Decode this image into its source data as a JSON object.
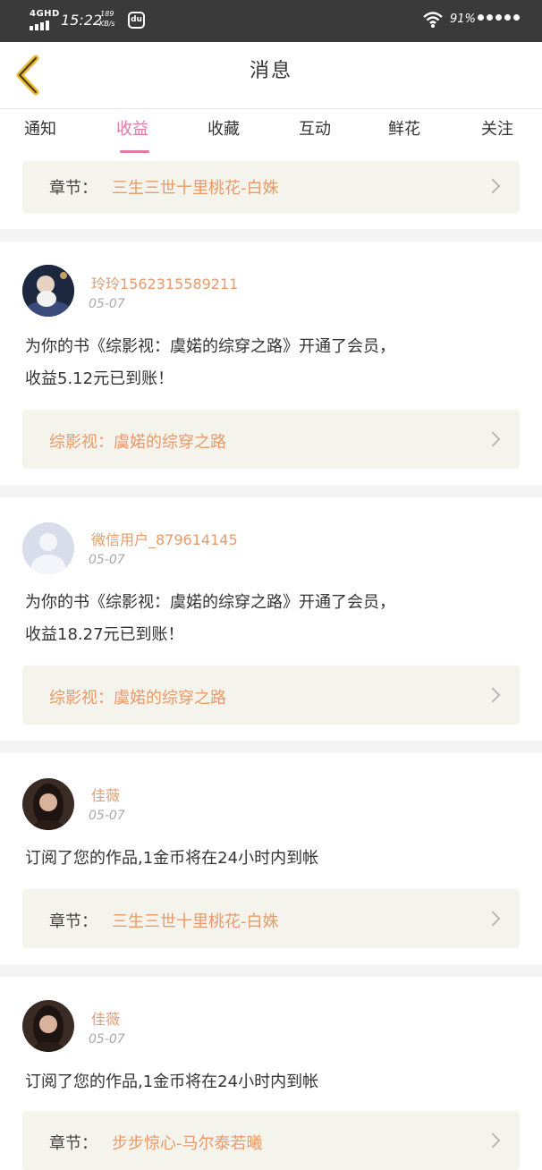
{
  "status": {
    "network": "4GHD",
    "time": "15:22",
    "speed_value": "189",
    "speed_unit": "KB/s",
    "battery": "91%",
    "app_icon_text": "du"
  },
  "header": {
    "title": "消息",
    "back_icon": "chevron-left-icon",
    "accent_color": "#e8b832"
  },
  "tabs": [
    "通知",
    "收益",
    "收藏",
    "互动",
    "鲜花",
    "关注"
  ],
  "active_tab": "收益",
  "colors": {
    "accent": "#e07aa6",
    "orange": "#e89a6a",
    "card_bg": "#f5f4ec"
  },
  "top_card": {
    "label": "章节：",
    "value": "三生三世十里桃花-白姝"
  },
  "messages": [
    {
      "username": "玲玲15623155892​11",
      "date": "05-07",
      "text_line1": "为你的书《综影视：虞婼的综穿之路》开通了会员，",
      "text_line2": "收益5.12元已到账！",
      "book": "综影视：虞婼的综穿之路"
    },
    {
      "username": "微信用户_879614145",
      "date": "05-07",
      "text_line1": "为你的书《综影视：虞婼的综穿之路》开通了会员，",
      "text_line2": "收益18.27元已到账！",
      "book": "综影视：虞婼的综穿之路"
    },
    {
      "username": "佳薇",
      "date": "05-07",
      "text": "订阅了您的作品,1金币将在24小时内到帐",
      "label": "章节：",
      "chapter": "三生三世十里桃花-白姝"
    },
    {
      "username": "佳薇",
      "date": "05-07",
      "text": "订阅了您的作品,1金币将在24小时内到帐",
      "label": "章节：",
      "chapter": "步步惊心-马尔泰若曦"
    }
  ]
}
